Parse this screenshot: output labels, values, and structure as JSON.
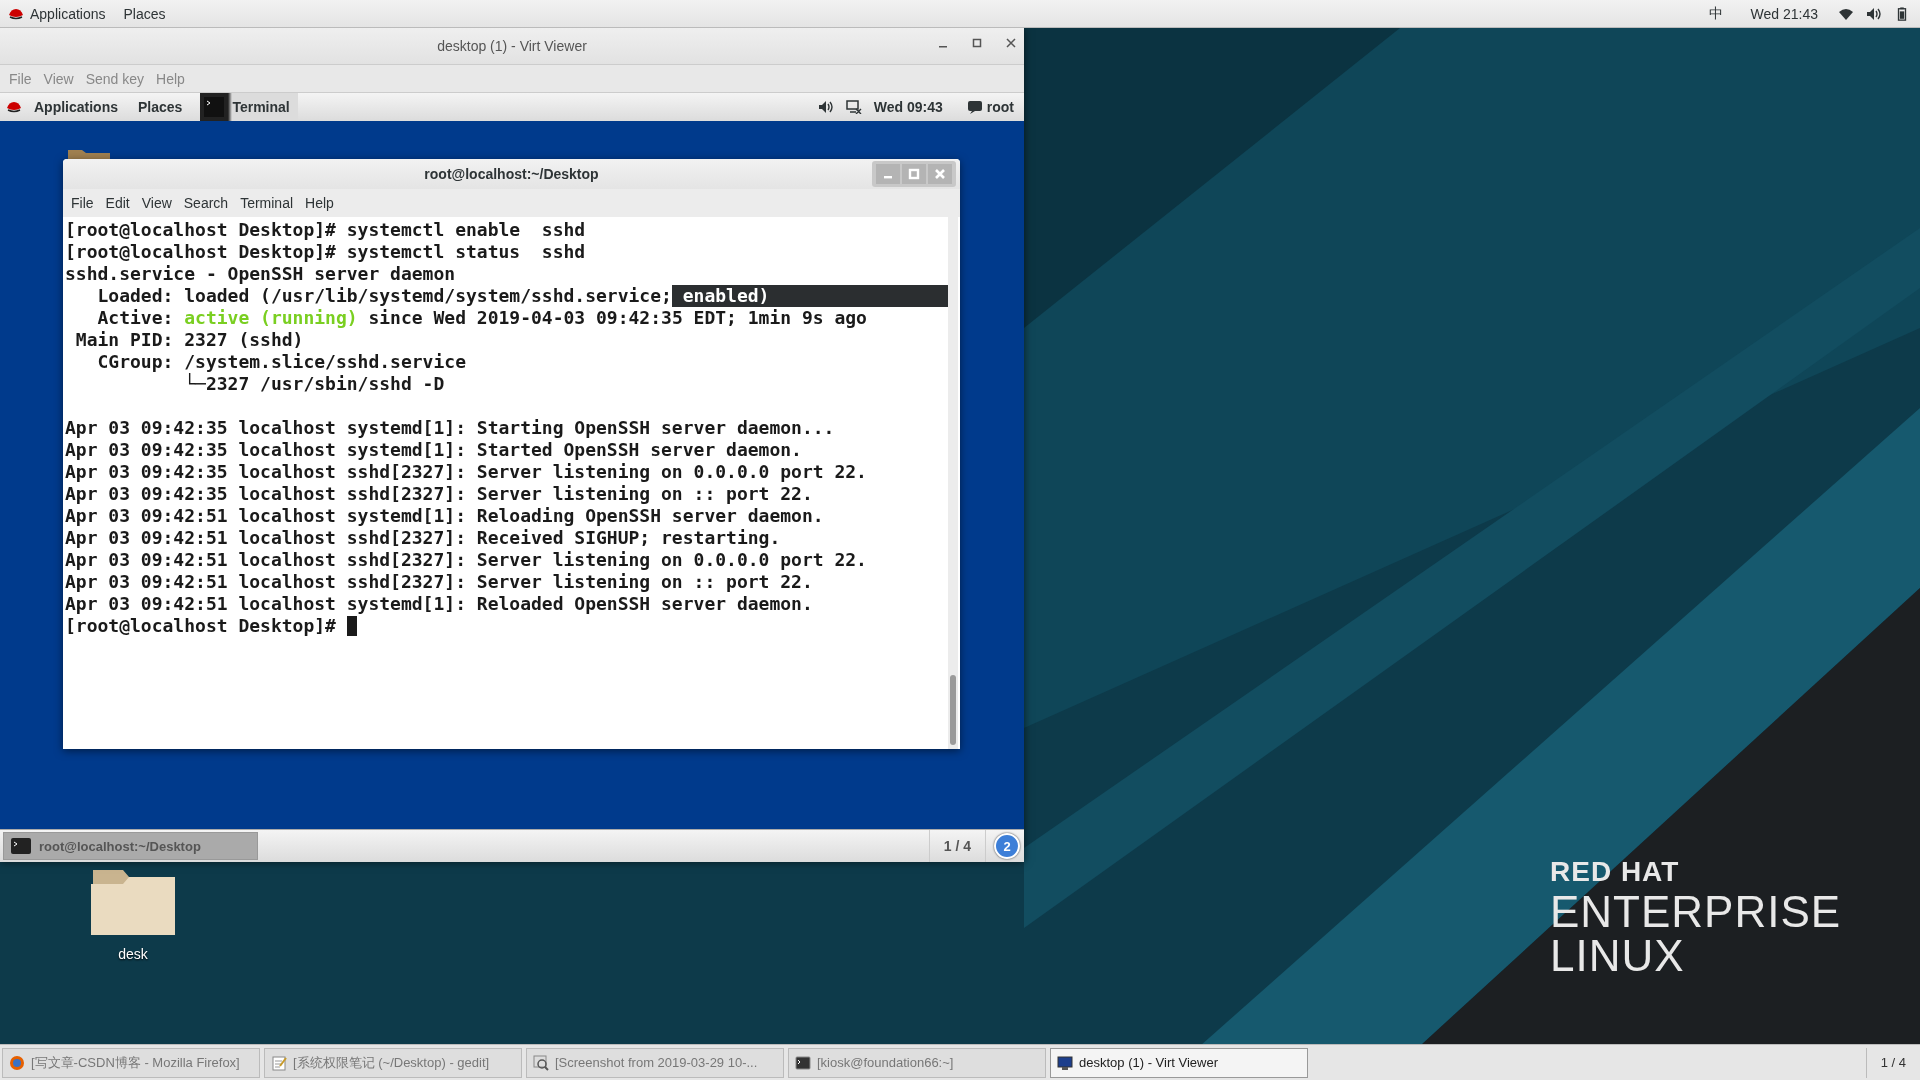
{
  "top_bar": {
    "menus": [
      "Applications",
      "Places"
    ],
    "input_method": "中",
    "clock": "Wed 21:43"
  },
  "viewer_window": {
    "title": "desktop (1) - Virt Viewer",
    "menu": [
      "File",
      "View",
      "Send key",
      "Help"
    ],
    "guest": {
      "top_bar": {
        "menus": [
          "Applications",
          "Places"
        ],
        "active_app": "Terminal",
        "clock": "Wed 09:43",
        "user": "root"
      },
      "terminal": {
        "title": "root@localhost:~/Desktop",
        "menu": [
          "File",
          "Edit",
          "View",
          "Search",
          "Terminal",
          "Help"
        ],
        "blocks": [
          [
            {
              "segments": [
                {
                  "text": "[root@localhost Desktop]# systemctl enable  sshd",
                  "kind": "plain"
                }
              ]
            },
            {
              "segments": [
                {
                  "text": "[root@localhost Desktop]# systemctl status  sshd",
                  "kind": "plain"
                }
              ]
            },
            {
              "segments": [
                {
                  "text": "sshd.service - OpenSSH server daemon",
                  "kind": "plain"
                }
              ]
            },
            {
              "segments": [
                {
                  "text": "   Loaded: loaded (/usr/lib/systemd/system/sshd.service;",
                  "kind": "plain"
                },
                {
                  "text": " enabled)",
                  "kind": "highlight"
                }
              ]
            },
            {
              "segments": [
                {
                  "text": "   Active: ",
                  "kind": "plain"
                },
                {
                  "text": "active (running)",
                  "kind": "green"
                },
                {
                  "text": " since Wed 2019-04-03 09:42:35 EDT; 1min 9s ago",
                  "kind": "plain"
                }
              ]
            },
            {
              "segments": [
                {
                  "text": " Main PID: 2327 (sshd)",
                  "kind": "plain"
                }
              ]
            },
            {
              "segments": [
                {
                  "text": "   CGroup: /system.slice/sshd.service",
                  "kind": "plain"
                }
              ]
            },
            {
              "segments": [
                {
                  "text": "           └─2327 /usr/sbin/sshd -D",
                  "kind": "plain"
                }
              ]
            }
          ],
          [
            {
              "segments": [
                {
                  "text": "Apr 03 09:42:35 localhost systemd[1]: Starting OpenSSH server daemon...",
                  "kind": "plain"
                }
              ]
            },
            {
              "segments": [
                {
                  "text": "Apr 03 09:42:35 localhost systemd[1]: Started OpenSSH server daemon.",
                  "kind": "plain"
                }
              ]
            },
            {
              "segments": [
                {
                  "text": "Apr 03 09:42:35 localhost sshd[2327]: Server listening on 0.0.0.0 port 22.",
                  "kind": "plain"
                }
              ]
            },
            {
              "segments": [
                {
                  "text": "Apr 03 09:42:35 localhost sshd[2327]: Server listening on :: port 22.",
                  "kind": "plain"
                }
              ]
            },
            {
              "segments": [
                {
                  "text": "Apr 03 09:42:51 localhost systemd[1]: Reloading OpenSSH server daemon.",
                  "kind": "plain"
                }
              ]
            },
            {
              "segments": [
                {
                  "text": "Apr 03 09:42:51 localhost sshd[2327]: Received SIGHUP; restarting.",
                  "kind": "plain"
                }
              ]
            },
            {
              "segments": [
                {
                  "text": "Apr 03 09:42:51 localhost sshd[2327]: Server listening on 0.0.0.0 port 22.",
                  "kind": "plain"
                }
              ]
            },
            {
              "segments": [
                {
                  "text": "Apr 03 09:42:51 localhost sshd[2327]: Server listening on :: port 22.",
                  "kind": "plain"
                }
              ]
            },
            {
              "segments": [
                {
                  "text": "Apr 03 09:42:51 localhost systemd[1]: Reloaded OpenSSH server daemon.",
                  "kind": "plain"
                }
              ]
            },
            {
              "segments": [
                {
                  "text": "[root@localhost Desktop]# ",
                  "kind": "plain"
                }
              ],
              "cursor": true
            }
          ]
        ]
      },
      "bottom_bar": {
        "window_button": "root@localhost:~/Desktop",
        "workspace": "1 / 4",
        "notification_count": "2"
      }
    }
  },
  "desktop_icons": [
    {
      "label": "desk"
    }
  ],
  "logo": {
    "line_1": "RED HAT",
    "line_2": "ENTERPRISE",
    "line_3": "LINUX"
  },
  "taskbar": {
    "items": [
      {
        "label": "[写文章-CSDN博客 - Mozilla Firefox]",
        "kind": "firefox",
        "selected": false
      },
      {
        "label": "[系统权限笔记 (~/Desktop) - gedit]",
        "kind": "editor",
        "selected": false
      },
      {
        "label": "[Screenshot from 2019-03-29 10-...",
        "kind": "screenshot",
        "selected": false
      },
      {
        "label": "[kiosk@foundation66:~]",
        "kind": "terminal",
        "selected": false
      },
      {
        "label": "desktop (1) - Virt Viewer",
        "kind": "viewer",
        "selected": true
      }
    ],
    "workspace": "1 / 4"
  }
}
